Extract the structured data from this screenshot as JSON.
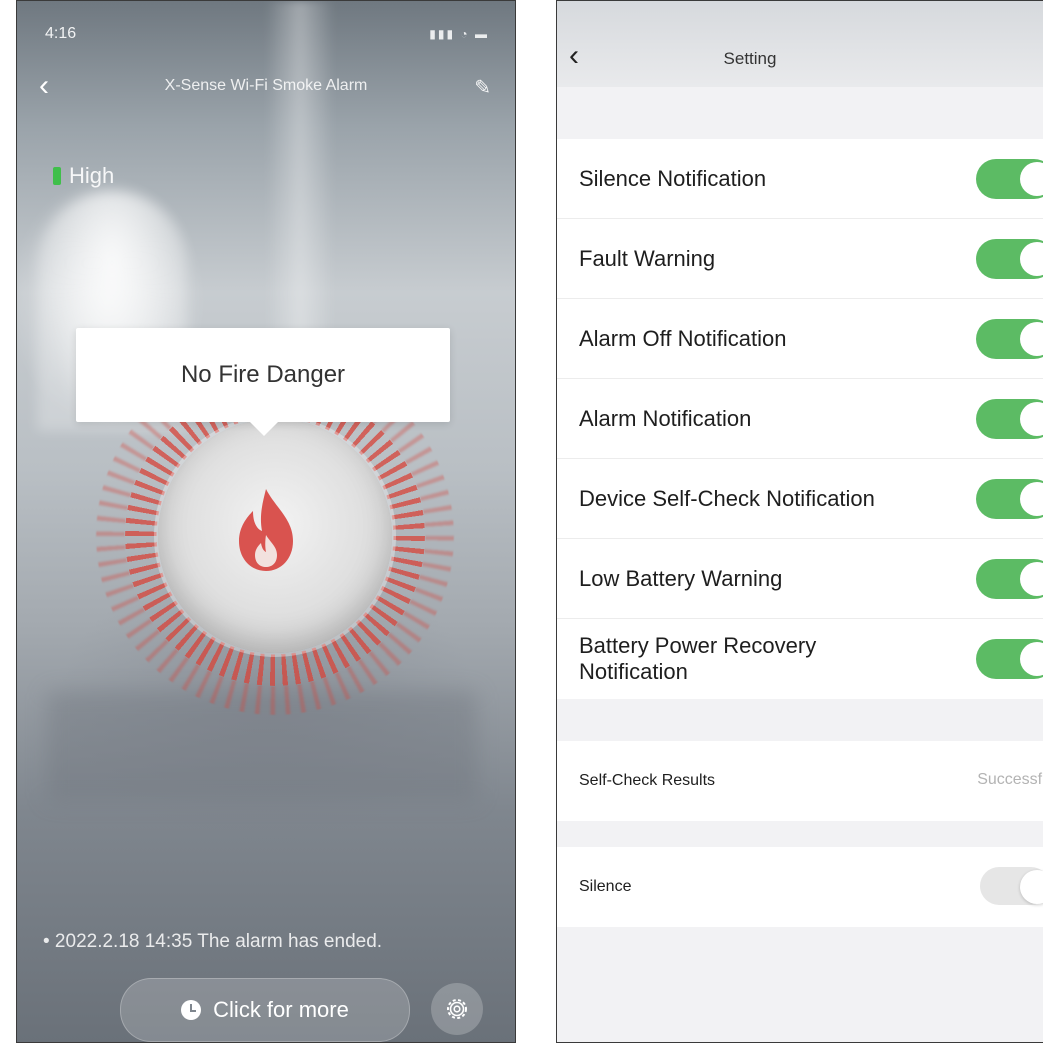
{
  "left": {
    "status_time": "4:16",
    "title": "X-Sense Wi-Fi Smoke Alarm",
    "battery_label": "High",
    "status_message": "No Fire Danger",
    "event_text": "• 2022.2.18 14:35 The alarm has ended.",
    "more_button_label": "Click for more",
    "colors": {
      "battery": "#3fbf4a",
      "flame": "#d9534f"
    }
  },
  "right": {
    "title": "Setting",
    "settings": [
      {
        "label": "Silence Notification",
        "on": true
      },
      {
        "label": "Fault Warning",
        "on": true
      },
      {
        "label": "Alarm Off Notification",
        "on": true
      },
      {
        "label": "Alarm Notification",
        "on": true
      },
      {
        "label": "Device Self-Check Notification",
        "on": true
      },
      {
        "label": "Low Battery Warning",
        "on": true
      },
      {
        "label": "Battery Power Recovery Notification",
        "on": true
      }
    ],
    "self_check": {
      "label": "Self-Check Results",
      "value": "Successfu"
    },
    "silence": {
      "label": "Silence",
      "on": false
    },
    "colors": {
      "toggle_on": "#5cbb64",
      "toggle_off": "#e6e6e6"
    }
  }
}
